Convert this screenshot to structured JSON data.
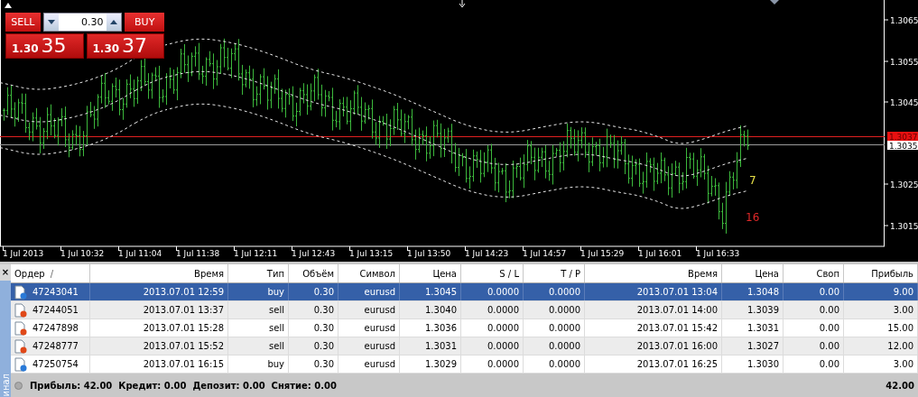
{
  "chart": {
    "price_axis": [
      "1.3065",
      "1.3055",
      "1.3045",
      "1.3025",
      "1.3015"
    ],
    "ask_label": "1.3037",
    "bid_label": "1.3035",
    "time_axis": [
      "1 Jul 2013",
      "1 Jul 10:32",
      "1 Jul 11:04",
      "1 Jul 11:38",
      "1 Jul 12:11",
      "1 Jul 12:43",
      "1 Jul 13:15",
      "1 Jul 13:50",
      "1 Jul 14:23",
      "1 Jul 14:57",
      "1 Jul 15:29",
      "1 Jul 16:01",
      "1 Jul 16:33"
    ],
    "band_labels": [
      {
        "text": "7",
        "color": "#e8e048"
      },
      {
        "text": "16",
        "color": "#e02828"
      }
    ]
  },
  "trade_panel": {
    "sell": "SELL",
    "buy": "BUY",
    "volume": "0.30",
    "bid": {
      "prefix": "1.30",
      "big": "35"
    },
    "ask": {
      "prefix": "1.30",
      "big": "37"
    }
  },
  "terminal": {
    "close": "×",
    "tab_label": "инал",
    "sort_mark": "/",
    "columns": [
      "Ордер",
      "Время",
      "Тип",
      "Объём",
      "Символ",
      "Цена",
      "S / L",
      "T / P",
      "Время",
      "Цена",
      "Своп",
      "Прибыль"
    ],
    "rows": [
      {
        "kind": "buy",
        "selected": true,
        "cells": [
          "47243041",
          "2013.07.01 12:59",
          "buy",
          "0.30",
          "eurusd",
          "1.3045",
          "0.0000",
          "0.0000",
          "2013.07.01 13:04",
          "1.3048",
          "0.00",
          "9.00"
        ]
      },
      {
        "kind": "sell",
        "selected": false,
        "cells": [
          "47244051",
          "2013.07.01 13:37",
          "sell",
          "0.30",
          "eurusd",
          "1.3040",
          "0.0000",
          "0.0000",
          "2013.07.01 14:00",
          "1.3039",
          "0.00",
          "3.00"
        ]
      },
      {
        "kind": "sell",
        "selected": false,
        "cells": [
          "47247898",
          "2013.07.01 15:28",
          "sell",
          "0.30",
          "eurusd",
          "1.3036",
          "0.0000",
          "0.0000",
          "2013.07.01 15:42",
          "1.3031",
          "0.00",
          "15.00"
        ]
      },
      {
        "kind": "sell",
        "selected": false,
        "cells": [
          "47248777",
          "2013.07.01 15:52",
          "sell",
          "0.30",
          "eurusd",
          "1.3031",
          "0.0000",
          "0.0000",
          "2013.07.01 16:00",
          "1.3027",
          "0.00",
          "12.00"
        ]
      },
      {
        "kind": "buy",
        "selected": false,
        "cells": [
          "47250754",
          "2013.07.01 16:15",
          "buy",
          "0.30",
          "eurusd",
          "1.3029",
          "0.0000",
          "0.0000",
          "2013.07.01 16:25",
          "1.3030",
          "0.00",
          "3.00"
        ]
      }
    ],
    "summary": {
      "text": "Прибыль: 42.00  Кредит: 0.00  Депозит: 0.00  Снятие: 0.00",
      "total": "42.00"
    }
  }
}
